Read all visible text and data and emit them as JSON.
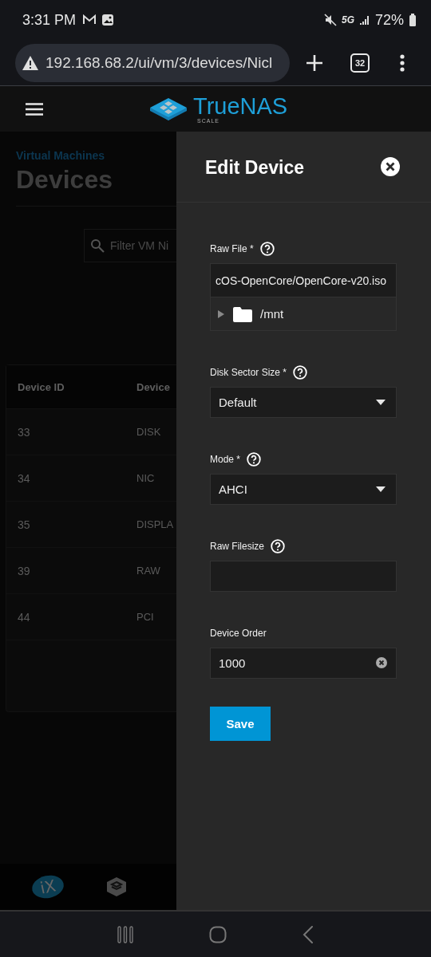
{
  "status_bar": {
    "time": "3:31 PM",
    "battery": "72%",
    "network": "5G"
  },
  "browser": {
    "url": "192.168.68.2/ui/vm/3/devices/Nicl",
    "tab_count": "32"
  },
  "app_header": {
    "logo_text": "TrueNAS",
    "logo_subtext": "SCALE"
  },
  "page": {
    "breadcrumb": "Virtual Machines",
    "title": "Devices",
    "filter_placeholder": "Filter VM Ni",
    "table": {
      "columns": [
        "Device ID",
        "Device"
      ],
      "rows": [
        [
          "33",
          "DISK"
        ],
        [
          "34",
          "NIC"
        ],
        [
          "35",
          "DISPLA"
        ],
        [
          "39",
          "RAW"
        ],
        [
          "44",
          "PCI"
        ]
      ]
    },
    "footer_logo_text": "iX"
  },
  "panel": {
    "title": "Edit Device",
    "fields": [
      {
        "kind": "file",
        "label": "Raw File *",
        "help": true,
        "value": "cOS-OpenCore/OpenCore-v20.iso",
        "tree": [
          {
            "name": "/mnt",
            "expanded": false
          }
        ]
      },
      {
        "kind": "select",
        "label": "Disk Sector Size *",
        "help": true,
        "value": "Default"
      },
      {
        "kind": "select",
        "label": "Mode *",
        "help": true,
        "value": "AHCI"
      },
      {
        "kind": "text",
        "label": "Raw Filesize",
        "help": true
      },
      {
        "kind": "text",
        "label": "Device Order",
        "help": false,
        "value": "1000",
        "clearable": true
      }
    ],
    "save_label": "Save"
  }
}
